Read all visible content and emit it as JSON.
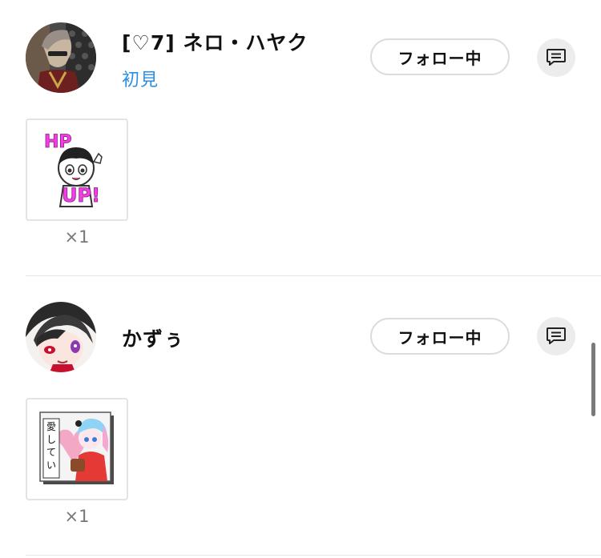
{
  "entries": [
    {
      "username": "[♡7]  ネロ・ハヤク",
      "badge": "初見",
      "follow_label": "フォロー中",
      "message_icon": "message-icon",
      "gift": {
        "icon": "hp-up-sticker-icon",
        "count": "×1"
      }
    },
    {
      "username": "かずぅ",
      "follow_label": "フォロー中",
      "message_icon": "message-icon",
      "gift": {
        "icon": "love-sticker-icon",
        "count": "×1"
      }
    }
  ],
  "colors": {
    "badge_blue": "#2b8ee6",
    "follow_border": "#dcdcdc",
    "message_bg": "#ececec",
    "divider": "#e6e6e6"
  }
}
